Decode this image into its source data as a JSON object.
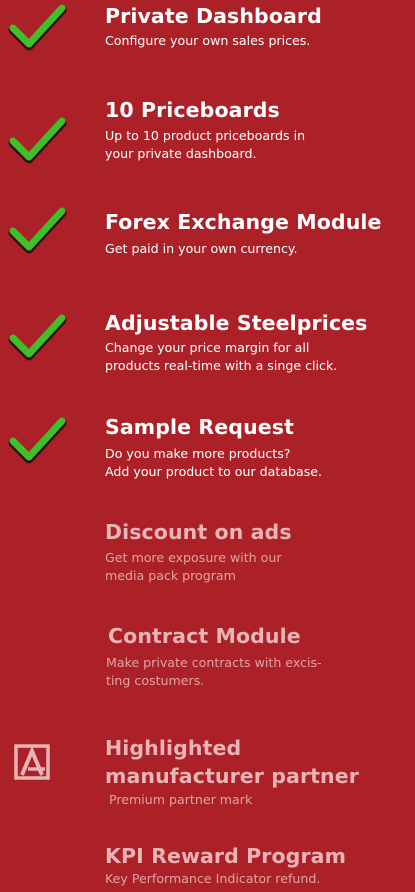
{
  "features": [
    {
      "title": "Private Dashboard",
      "desc": "Configure your own sales prices.",
      "icon": "check-icon"
    },
    {
      "title": "10 Priceboards",
      "desc": "Up to 10 product priceboards in\nyour private dashboard.",
      "icon": "check-icon"
    },
    {
      "title": "Forex Exchange Module",
      "desc": "Get paid in your own currency.",
      "icon": "check-icon"
    },
    {
      "title": "Adjustable Steelprices",
      "desc": "Change your price margin for all\nproducts real-time with a singe click.",
      "icon": "check-icon"
    },
    {
      "title": "Sample Request",
      "desc": "Do you make more products?\nAdd your product to our database.",
      "icon": "check-icon"
    },
    {
      "title": "Discount on ads",
      "desc": "Get more exposure with our\nmedia pack program",
      "icon": ""
    },
    {
      "title": "Contract Module",
      "desc": "Make private contracts with excis-\nting costumers.",
      "icon": ""
    },
    {
      "title": "Highlighted\nmanufacturer partner",
      "desc": "Premium partner mark",
      "icon": "partner-logo-icon"
    },
    {
      "title": "KPI Reward Program",
      "desc": "Key Performance Indicator refund.",
      "icon": ""
    }
  ],
  "colors": {
    "background": "#ac2128",
    "check": "#3fbf2a",
    "muted_text": "#e8b4b6"
  }
}
